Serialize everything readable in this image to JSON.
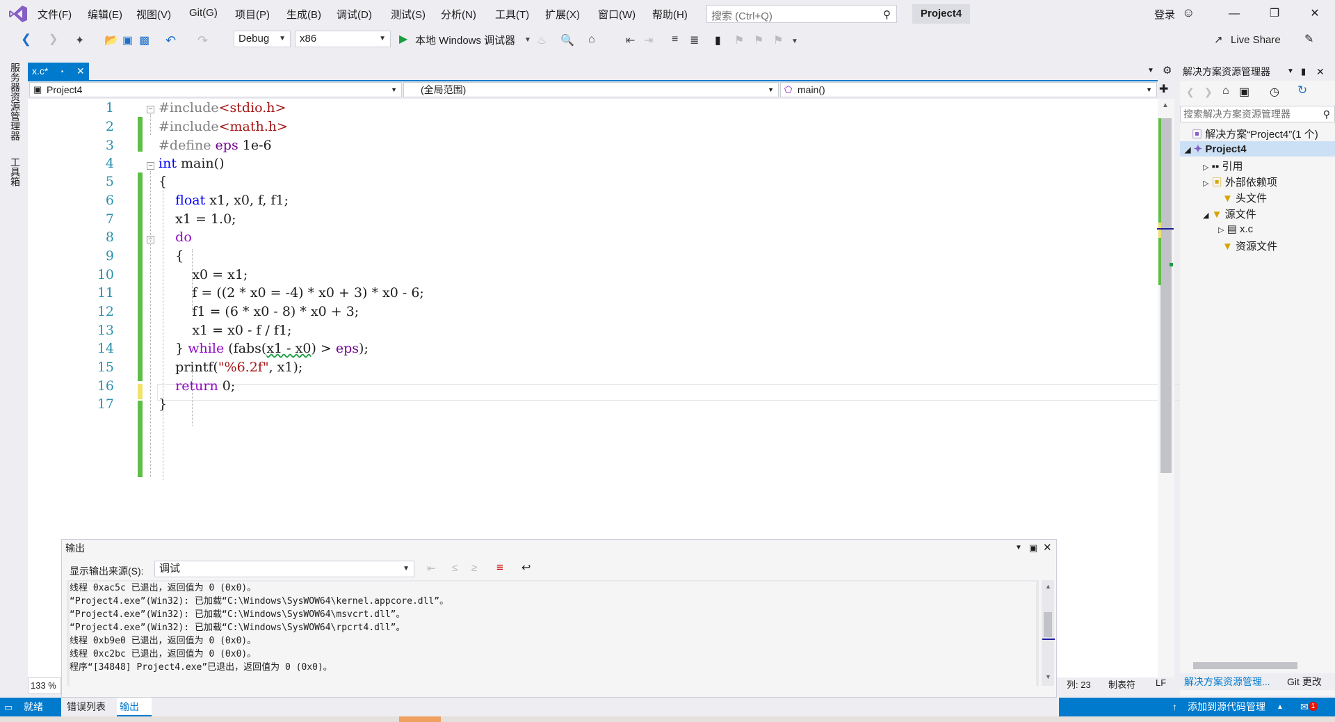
{
  "menu": {
    "items": [
      "文件(F)",
      "编辑(E)",
      "视图(V)",
      "Git(G)",
      "项目(P)",
      "生成(B)",
      "调试(D)",
      "测试(S)",
      "分析(N)",
      "工具(T)",
      "扩展(X)",
      "窗口(W)",
      "帮助(H)"
    ],
    "search_placeholder": "搜索 (Ctrl+Q)",
    "project_title": "Project4",
    "login": "登录"
  },
  "toolbar": {
    "config": "Debug",
    "platform": "x86",
    "debugger": "本地 Windows 调试器",
    "live_share": "Live Share"
  },
  "left_strip": {
    "server_explorer": "服务器资源管理器",
    "toolbox": "工具箱"
  },
  "editor": {
    "tab_label": "x.c*",
    "project_dropdown": "Project4",
    "scope_dropdown": "(全局范围)",
    "member_dropdown": "main()",
    "line_numbers": [
      "1",
      "2",
      "3",
      "4",
      "5",
      "6",
      "7",
      "8",
      "9",
      "10",
      "11",
      "12",
      "13",
      "14",
      "15",
      "16",
      "17"
    ],
    "zoom": "133 %"
  },
  "solution_explorer": {
    "title": "解决方案资源管理器",
    "search_placeholder": "搜索解决方案资源管理器",
    "solution": "解决方案“Project4”(1 个)",
    "project": "Project4",
    "references": "引用",
    "external_deps": "外部依赖项",
    "headers": "头文件",
    "sources": "源文件",
    "source_file": "x.c",
    "resources": "资源文件",
    "tab_solution": "解决方案资源管理...",
    "tab_git": "Git 更改"
  },
  "output": {
    "title": "输出",
    "source_label": "显示输出来源(S):",
    "source_value": "调试",
    "lines": [
      "线程 0xac5c 已退出，返回值为 0 (0x0)。",
      "“Project4.exe”(Win32): 已加载“C:\\Windows\\SysWOW64\\kernel.appcore.dll”。",
      "“Project4.exe”(Win32): 已加载“C:\\Windows\\SysWOW64\\msvcrt.dll”。",
      "“Project4.exe”(Win32): 已加载“C:\\Windows\\SysWOW64\\rpcrt4.dll”。",
      "线程 0xb9e0 已退出，返回值为 0 (0x0)。",
      "线程 0xc2bc 已退出，返回值为 0 (0x0)。",
      "程序“[34848] Project4.exe”已退出，返回值为 0 (0x0)。"
    ]
  },
  "statusbar": {
    "ready": "就绪",
    "tab_errors": "错误列表",
    "tab_output": "输出",
    "col": "列: 23",
    "tabs": "制表符",
    "eol": "LF",
    "add_source": "添加到源代码管理",
    "notif_count": "1"
  },
  "colors": {
    "accent": "#007acc",
    "keyword": "#0000ff",
    "line_number": "#2b91af",
    "string": "#a31515",
    "changed": "#5fbe45"
  }
}
